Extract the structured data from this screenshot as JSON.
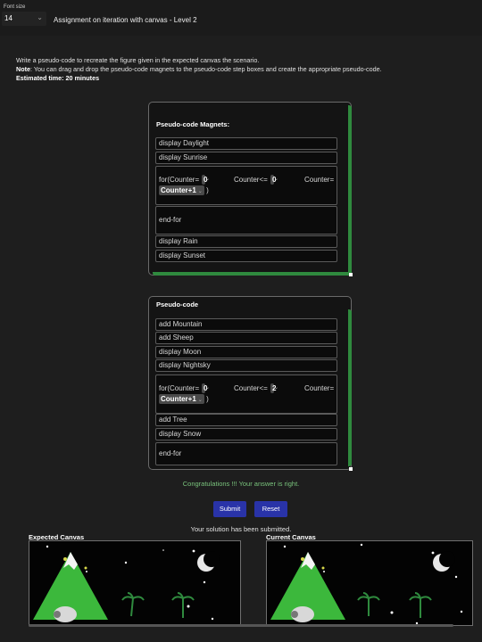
{
  "header": {
    "font_size_label": "Font size",
    "font_size_value": "14",
    "chevron_icon": "chevron-down-icon",
    "title": "Assignment on iteration with canvas - Level 2"
  },
  "instructions": {
    "line1": "Write a pseudo-code to recreate the figure given in the expected canvas the scenario.",
    "note_label": "Note",
    "note_text": ": You can drag and drop the pseudo-code magnets to the pseudo-code step boxes and create the appropriate pseudo-code.",
    "time": "Estimated time: 20 minutes"
  },
  "magnets_panel": {
    "title": "Pseudo-code Magnets:",
    "items": [
      "display Daylight",
      "display Sunrise"
    ],
    "for_block": {
      "prefix": "for(Counter=",
      "start": "0",
      "cond": "Counter<=",
      "end": "0",
      "step_label": "Counter=",
      "step": "Counter+1",
      "close": ")"
    },
    "end_for": "end-for",
    "items_after": [
      "display Rain",
      "display Sunset"
    ]
  },
  "pseudocode_panel": {
    "title": "Pseudo-code",
    "items": [
      "add Mountain",
      "add Sheep",
      "display Moon",
      "display Nightsky"
    ],
    "for_block": {
      "prefix": "for(Counter=",
      "start": "0",
      "cond": "Counter<=",
      "end": "2",
      "step_label": "Counter=",
      "step": "Counter+1",
      "close": ")"
    },
    "items_after": [
      "add Tree",
      "display Snow"
    ],
    "end_for": "end-for"
  },
  "result": {
    "message": "Congratulations !!! Your answer is right.",
    "submit_label": "Submit",
    "reset_label": "Reset",
    "submitted": "Your solution has been submitted."
  },
  "canvases": {
    "expected_label": "Expected Canvas",
    "current_label": "Current Canvas"
  },
  "colors": {
    "accent_green": "#2f8a3e",
    "button_blue": "#2933a8",
    "success_text": "#79c37c"
  }
}
